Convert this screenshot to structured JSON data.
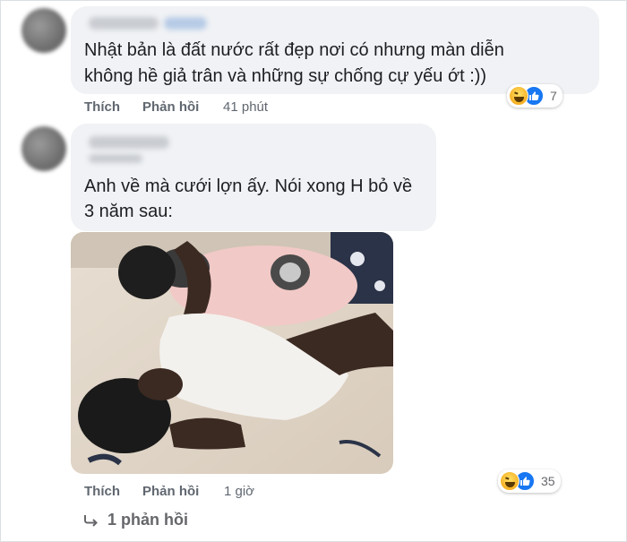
{
  "comments": [
    {
      "text_line1": "Nhật bản là đất nước rất đẹp nơi có nhưng màn diễn",
      "text_line2": "không hề giả trân và những sự chống cự yếu ớt :))",
      "actions": {
        "like": "Thích",
        "reply": "Phản hồi",
        "time": "41 phút"
      },
      "reactions": {
        "icons": [
          "haha-icon",
          "like-icon"
        ],
        "count": "7"
      }
    },
    {
      "text_line1": "Anh về mà cưới lợn ấy. Nói xong H bỏ về",
      "text_line2": "3 năm sau:",
      "actions": {
        "like": "Thích",
        "reply": "Phản hồi",
        "time": "1 giờ"
      },
      "reactions": {
        "icons": [
          "haha-icon",
          "like-icon"
        ],
        "count": "35"
      },
      "replies_label": "1 phản hồi"
    }
  ],
  "colors": {
    "bubble": "#f0f2f5",
    "action_text": "#606770",
    "like_blue": "#1877f2",
    "haha_yellow": "#f7b125"
  }
}
